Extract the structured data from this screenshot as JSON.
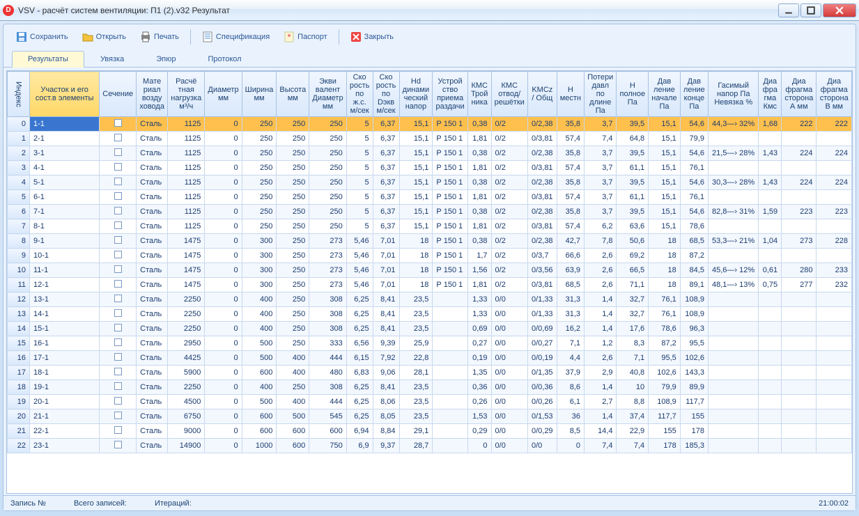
{
  "window": {
    "title": "VSV - расчёт систем вентиляции: П1 (2).v32 Результат"
  },
  "toolbar": {
    "save": "Сохранить",
    "open": "Открыть",
    "print": "Печать",
    "spec": "Спецификация",
    "passport": "Паспорт",
    "close": "Закрыть"
  },
  "tabs": {
    "results": "Результаты",
    "uvyazka": "Увязка",
    "epyur": "Эпюр",
    "protocol": "Протокол"
  },
  "columns": [
    "Индекс",
    "Участок и его сост.в элементы",
    "Сечение",
    "Мате риал возду ховода",
    "Расчё тная нагрузка м³/ч",
    "Диаметр мм",
    "Ширина мм",
    "Высота мм",
    "Экви валент Диаметр мм",
    "Ско рость по ж.с. м/сек",
    "Ско рость по Dэкв м/сек",
    "Hd динами ческий напор",
    "Устрой ство приема раздачи",
    "КМС Трой ника",
    "КМС отвод/ решётки",
    "KMCz / Общ",
    "H местн",
    "Потери давл по длине Па",
    "H полное Па",
    "Дав ление начале Па",
    "Дав ление конце Па",
    "Гасимый напор Па Невязка %",
    "Диа фра гма Кмс",
    "Диа фрагма сторона А мм",
    "Диа фрагма сторона В мм"
  ],
  "rows": [
    {
      "i": 0,
      "u": "1-1",
      "mat": "Сталь",
      "q": "1125",
      "d": "0",
      "w": "250",
      "h": "250",
      "de": "250",
      "v1": "5",
      "v2": "6,37",
      "hd": "15,1",
      "dev": "Р 150 1",
      "k1": "0,38",
      "k2": "0/2",
      "kz": "0/2,38",
      "hm": "35,8",
      "pl": "3,7",
      "hp": "39,5",
      "pn": "15,1",
      "pk": "54,6",
      "gn": "44,3—› 32%",
      "dk": "1,68",
      "da": "222",
      "db": "222"
    },
    {
      "i": 1,
      "u": "2-1",
      "mat": "Сталь",
      "q": "1125",
      "d": "0",
      "w": "250",
      "h": "250",
      "de": "250",
      "v1": "5",
      "v2": "6,37",
      "hd": "15,1",
      "dev": "Р 150 1",
      "k1": "1,81",
      "k2": "0/2",
      "kz": "0/3,81",
      "hm": "57,4",
      "pl": "7,4",
      "hp": "64,8",
      "pn": "15,1",
      "pk": "79,9",
      "gn": "",
      "dk": "",
      "da": "",
      "db": ""
    },
    {
      "i": 2,
      "u": "3-1",
      "mat": "Сталь",
      "q": "1125",
      "d": "0",
      "w": "250",
      "h": "250",
      "de": "250",
      "v1": "5",
      "v2": "6,37",
      "hd": "15,1",
      "dev": "Р 150 1",
      "k1": "0,38",
      "k2": "0/2",
      "kz": "0/2,38",
      "hm": "35,8",
      "pl": "3,7",
      "hp": "39,5",
      "pn": "15,1",
      "pk": "54,6",
      "gn": "21,5—› 28%",
      "dk": "1,43",
      "da": "224",
      "db": "224"
    },
    {
      "i": 3,
      "u": "4-1",
      "mat": "Сталь",
      "q": "1125",
      "d": "0",
      "w": "250",
      "h": "250",
      "de": "250",
      "v1": "5",
      "v2": "6,37",
      "hd": "15,1",
      "dev": "Р 150 1",
      "k1": "1,81",
      "k2": "0/2",
      "kz": "0/3,81",
      "hm": "57,4",
      "pl": "3,7",
      "hp": "61,1",
      "pn": "15,1",
      "pk": "76,1",
      "gn": "",
      "dk": "",
      "da": "",
      "db": ""
    },
    {
      "i": 4,
      "u": "5-1",
      "mat": "Сталь",
      "q": "1125",
      "d": "0",
      "w": "250",
      "h": "250",
      "de": "250",
      "v1": "5",
      "v2": "6,37",
      "hd": "15,1",
      "dev": "Р 150 1",
      "k1": "0,38",
      "k2": "0/2",
      "kz": "0/2,38",
      "hm": "35,8",
      "pl": "3,7",
      "hp": "39,5",
      "pn": "15,1",
      "pk": "54,6",
      "gn": "30,3—› 28%",
      "dk": "1,43",
      "da": "224",
      "db": "224"
    },
    {
      "i": 5,
      "u": "6-1",
      "mat": "Сталь",
      "q": "1125",
      "d": "0",
      "w": "250",
      "h": "250",
      "de": "250",
      "v1": "5",
      "v2": "6,37",
      "hd": "15,1",
      "dev": "Р 150 1",
      "k1": "1,81",
      "k2": "0/2",
      "kz": "0/3,81",
      "hm": "57,4",
      "pl": "3,7",
      "hp": "61,1",
      "pn": "15,1",
      "pk": "76,1",
      "gn": "",
      "dk": "",
      "da": "",
      "db": ""
    },
    {
      "i": 6,
      "u": "7-1",
      "mat": "Сталь",
      "q": "1125",
      "d": "0",
      "w": "250",
      "h": "250",
      "de": "250",
      "v1": "5",
      "v2": "6,37",
      "hd": "15,1",
      "dev": "Р 150 1",
      "k1": "0,38",
      "k2": "0/2",
      "kz": "0/2,38",
      "hm": "35,8",
      "pl": "3,7",
      "hp": "39,5",
      "pn": "15,1",
      "pk": "54,6",
      "gn": "82,8—› 31%",
      "dk": "1,59",
      "da": "223",
      "db": "223"
    },
    {
      "i": 7,
      "u": "8-1",
      "mat": "Сталь",
      "q": "1125",
      "d": "0",
      "w": "250",
      "h": "250",
      "de": "250",
      "v1": "5",
      "v2": "6,37",
      "hd": "15,1",
      "dev": "Р 150 1",
      "k1": "1,81",
      "k2": "0/2",
      "kz": "0/3,81",
      "hm": "57,4",
      "pl": "6,2",
      "hp": "63,6",
      "pn": "15,1",
      "pk": "78,6",
      "gn": "",
      "dk": "",
      "da": "",
      "db": ""
    },
    {
      "i": 8,
      "u": "9-1",
      "mat": "Сталь",
      "q": "1475",
      "d": "0",
      "w": "300",
      "h": "250",
      "de": "273",
      "v1": "5,46",
      "v2": "7,01",
      "hd": "18",
      "dev": "Р 150 1",
      "k1": "0,38",
      "k2": "0/2",
      "kz": "0/2,38",
      "hm": "42,7",
      "pl": "7,8",
      "hp": "50,6",
      "pn": "18",
      "pk": "68,5",
      "gn": "53,3—› 21%",
      "dk": "1,04",
      "da": "273",
      "db": "228"
    },
    {
      "i": 9,
      "u": "10-1",
      "mat": "Сталь",
      "q": "1475",
      "d": "0",
      "w": "300",
      "h": "250",
      "de": "273",
      "v1": "5,46",
      "v2": "7,01",
      "hd": "18",
      "dev": "Р 150 1",
      "k1": "1,7",
      "k2": "0/2",
      "kz": "0/3,7",
      "hm": "66,6",
      "pl": "2,6",
      "hp": "69,2",
      "pn": "18",
      "pk": "87,2",
      "gn": "",
      "dk": "",
      "da": "",
      "db": ""
    },
    {
      "i": 10,
      "u": "11-1",
      "mat": "Сталь",
      "q": "1475",
      "d": "0",
      "w": "300",
      "h": "250",
      "de": "273",
      "v1": "5,46",
      "v2": "7,01",
      "hd": "18",
      "dev": "Р 150 1",
      "k1": "1,56",
      "k2": "0/2",
      "kz": "0/3,56",
      "hm": "63,9",
      "pl": "2,6",
      "hp": "66,5",
      "pn": "18",
      "pk": "84,5",
      "gn": "45,6—› 12%",
      "dk": "0,61",
      "da": "280",
      "db": "233"
    },
    {
      "i": 11,
      "u": "12-1",
      "mat": "Сталь",
      "q": "1475",
      "d": "0",
      "w": "300",
      "h": "250",
      "de": "273",
      "v1": "5,46",
      "v2": "7,01",
      "hd": "18",
      "dev": "Р 150 1",
      "k1": "1,81",
      "k2": "0/2",
      "kz": "0/3,81",
      "hm": "68,5",
      "pl": "2,6",
      "hp": "71,1",
      "pn": "18",
      "pk": "89,1",
      "gn": "48,1—› 13%",
      "dk": "0,75",
      "da": "277",
      "db": "232"
    },
    {
      "i": 12,
      "u": "13-1",
      "mat": "Сталь",
      "q": "2250",
      "d": "0",
      "w": "400",
      "h": "250",
      "de": "308",
      "v1": "6,25",
      "v2": "8,41",
      "hd": "23,5",
      "dev": "",
      "k1": "1,33",
      "k2": "0/0",
      "kz": "0/1,33",
      "hm": "31,3",
      "pl": "1,4",
      "hp": "32,7",
      "pn": "76,1",
      "pk": "108,9",
      "gn": "",
      "dk": "",
      "da": "",
      "db": ""
    },
    {
      "i": 13,
      "u": "14-1",
      "mat": "Сталь",
      "q": "2250",
      "d": "0",
      "w": "400",
      "h": "250",
      "de": "308",
      "v1": "6,25",
      "v2": "8,41",
      "hd": "23,5",
      "dev": "",
      "k1": "1,33",
      "k2": "0/0",
      "kz": "0/1,33",
      "hm": "31,3",
      "pl": "1,4",
      "hp": "32,7",
      "pn": "76,1",
      "pk": "108,9",
      "gn": "",
      "dk": "",
      "da": "",
      "db": ""
    },
    {
      "i": 14,
      "u": "15-1",
      "mat": "Сталь",
      "q": "2250",
      "d": "0",
      "w": "400",
      "h": "250",
      "de": "308",
      "v1": "6,25",
      "v2": "8,41",
      "hd": "23,5",
      "dev": "",
      "k1": "0,69",
      "k2": "0/0",
      "kz": "0/0,69",
      "hm": "16,2",
      "pl": "1,4",
      "hp": "17,6",
      "pn": "78,6",
      "pk": "96,3",
      "gn": "",
      "dk": "",
      "da": "",
      "db": ""
    },
    {
      "i": 15,
      "u": "16-1",
      "mat": "Сталь",
      "q": "2950",
      "d": "0",
      "w": "500",
      "h": "250",
      "de": "333",
      "v1": "6,56",
      "v2": "9,39",
      "hd": "25,9",
      "dev": "",
      "k1": "0,27",
      "k2": "0/0",
      "kz": "0/0,27",
      "hm": "7,1",
      "pl": "1,2",
      "hp": "8,3",
      "pn": "87,2",
      "pk": "95,5",
      "gn": "",
      "dk": "",
      "da": "",
      "db": ""
    },
    {
      "i": 16,
      "u": "17-1",
      "mat": "Сталь",
      "q": "4425",
      "d": "0",
      "w": "500",
      "h": "400",
      "de": "444",
      "v1": "6,15",
      "v2": "7,92",
      "hd": "22,8",
      "dev": "",
      "k1": "0,19",
      "k2": "0/0",
      "kz": "0/0,19",
      "hm": "4,4",
      "pl": "2,6",
      "hp": "7,1",
      "pn": "95,5",
      "pk": "102,6",
      "gn": "",
      "dk": "",
      "da": "",
      "db": ""
    },
    {
      "i": 17,
      "u": "18-1",
      "mat": "Сталь",
      "q": "5900",
      "d": "0",
      "w": "600",
      "h": "400",
      "de": "480",
      "v1": "6,83",
      "v2": "9,06",
      "hd": "28,1",
      "dev": "",
      "k1": "1,35",
      "k2": "0/0",
      "kz": "0/1,35",
      "hm": "37,9",
      "pl": "2,9",
      "hp": "40,8",
      "pn": "102,6",
      "pk": "143,3",
      "gn": "",
      "dk": "",
      "da": "",
      "db": ""
    },
    {
      "i": 18,
      "u": "19-1",
      "mat": "Сталь",
      "q": "2250",
      "d": "0",
      "w": "400",
      "h": "250",
      "de": "308",
      "v1": "6,25",
      "v2": "8,41",
      "hd": "23,5",
      "dev": "",
      "k1": "0,36",
      "k2": "0/0",
      "kz": "0/0,36",
      "hm": "8,6",
      "pl": "1,4",
      "hp": "10",
      "pn": "79,9",
      "pk": "89,9",
      "gn": "",
      "dk": "",
      "da": "",
      "db": ""
    },
    {
      "i": 19,
      "u": "20-1",
      "mat": "Сталь",
      "q": "4500",
      "d": "0",
      "w": "500",
      "h": "400",
      "de": "444",
      "v1": "6,25",
      "v2": "8,06",
      "hd": "23,5",
      "dev": "",
      "k1": "0,26",
      "k2": "0/0",
      "kz": "0/0,26",
      "hm": "6,1",
      "pl": "2,7",
      "hp": "8,8",
      "pn": "108,9",
      "pk": "117,7",
      "gn": "",
      "dk": "",
      "da": "",
      "db": ""
    },
    {
      "i": 20,
      "u": "21-1",
      "mat": "Сталь",
      "q": "6750",
      "d": "0",
      "w": "600",
      "h": "500",
      "de": "545",
      "v1": "6,25",
      "v2": "8,05",
      "hd": "23,5",
      "dev": "",
      "k1": "1,53",
      "k2": "0/0",
      "kz": "0/1,53",
      "hm": "36",
      "pl": "1,4",
      "hp": "37,4",
      "pn": "117,7",
      "pk": "155",
      "gn": "",
      "dk": "",
      "da": "",
      "db": ""
    },
    {
      "i": 21,
      "u": "22-1",
      "mat": "Сталь",
      "q": "9000",
      "d": "0",
      "w": "600",
      "h": "600",
      "de": "600",
      "v1": "6,94",
      "v2": "8,84",
      "hd": "29,1",
      "dev": "",
      "k1": "0,29",
      "k2": "0/0",
      "kz": "0/0,29",
      "hm": "8,5",
      "pl": "14,4",
      "hp": "22,9",
      "pn": "155",
      "pk": "178",
      "gn": "",
      "dk": "",
      "da": "",
      "db": ""
    },
    {
      "i": 22,
      "u": "23-1",
      "mat": "Сталь",
      "q": "14900",
      "d": "0",
      "w": "1000",
      "h": "600",
      "de": "750",
      "v1": "6,9",
      "v2": "9,37",
      "hd": "28,7",
      "dev": "",
      "k1": "0",
      "k2": "0/0",
      "kz": "0/0",
      "hm": "0",
      "pl": "7,4",
      "hp": "7,4",
      "pn": "178",
      "pk": "185,3",
      "gn": "",
      "dk": "",
      "da": "",
      "db": ""
    }
  ],
  "status": {
    "rec": "Запись №",
    "total": "Всего записей:",
    "iter": "Итераций:",
    "time": "21:00:02"
  }
}
